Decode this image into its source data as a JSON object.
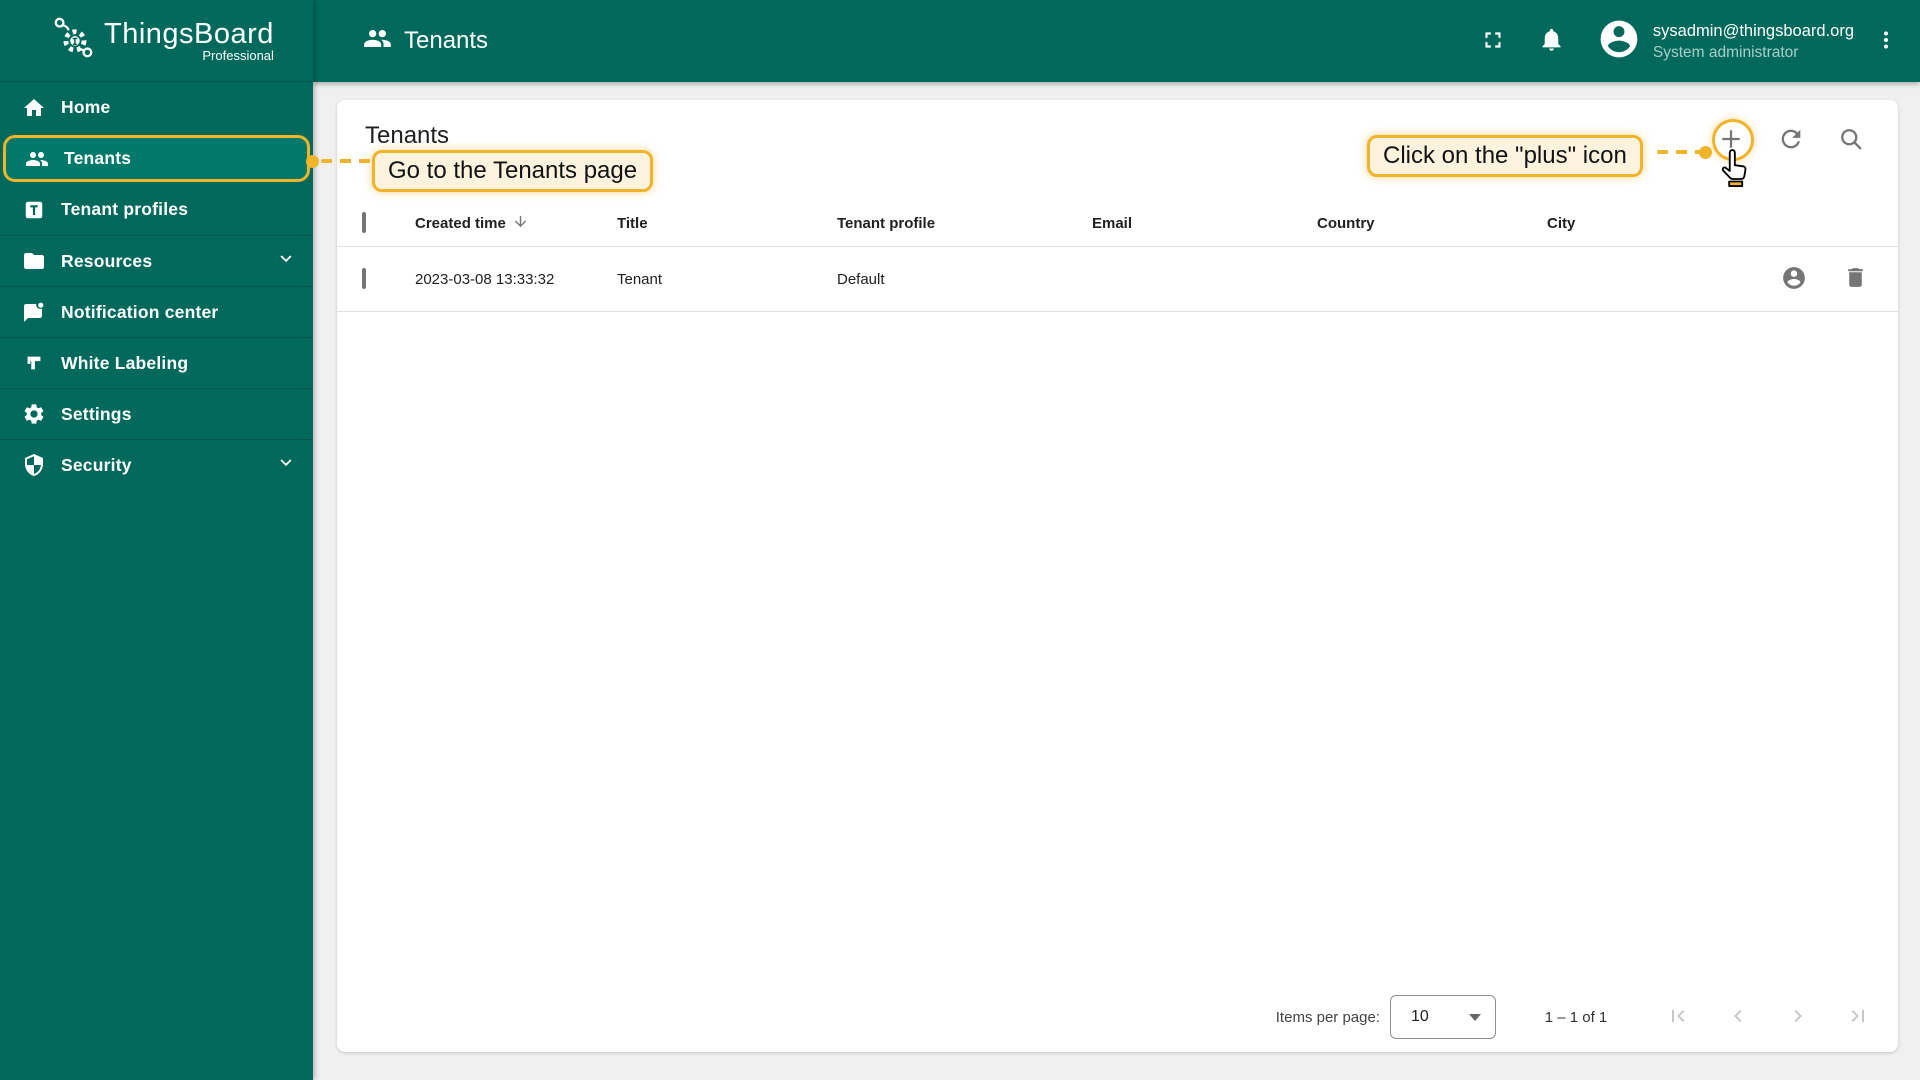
{
  "app": {
    "name": "ThingsBoard",
    "edition": "Professional"
  },
  "sidebar": {
    "items": [
      {
        "label": "Home",
        "icon": "home-icon",
        "selected": false
      },
      {
        "label": "Tenants",
        "icon": "people-icon",
        "selected": true
      },
      {
        "label": "Tenant profiles",
        "icon": "tenant-profile-icon",
        "selected": false
      },
      {
        "label": "Resources",
        "icon": "folder-icon",
        "selected": false,
        "expandable": true
      },
      {
        "label": "Notification center",
        "icon": "notification-icon",
        "selected": false
      },
      {
        "label": "White Labeling",
        "icon": "white-labeling-icon",
        "selected": false
      },
      {
        "label": "Settings",
        "icon": "gear-icon",
        "selected": false
      },
      {
        "label": "Security",
        "icon": "shield-icon",
        "selected": false,
        "expandable": true
      }
    ]
  },
  "header": {
    "title": "Tenants",
    "icons": [
      "fullscreen-icon",
      "bell-icon",
      "avatar-icon",
      "kebab-menu-icon"
    ],
    "user": {
      "email": "sysadmin@thingsboard.org",
      "role": "System administrator"
    }
  },
  "content": {
    "page_title": "Tenants",
    "toolbar_icons": [
      "plus-icon",
      "refresh-icon",
      "search-icon"
    ],
    "callouts": {
      "tenants": "Go to the Tenants page",
      "plus": "Click on the \"plus\" icon"
    }
  },
  "table": {
    "columns": [
      "Created time",
      "Title",
      "Tenant profile",
      "Email",
      "Country",
      "City"
    ],
    "sorted_column": "Created time",
    "sort_direction": "desc",
    "rows": [
      {
        "created_time": "2023-03-08 13:33:32",
        "title": "Tenant",
        "tenant_profile": "Default",
        "email": "",
        "country": "",
        "city": "",
        "actions": [
          "manage-user-icon",
          "delete-icon"
        ]
      }
    ]
  },
  "paginator": {
    "items_per_page_label": "Items per page:",
    "page_size": "10",
    "range": "1 – 1 of 1"
  },
  "colors": {
    "primary": "#00695c",
    "primary_selected": "#00796b",
    "accent_yellow": "#f0b42a",
    "callout_bg": "#fcf3de",
    "icon_gray": "#757575",
    "page_bg": "#f0f0f0"
  }
}
